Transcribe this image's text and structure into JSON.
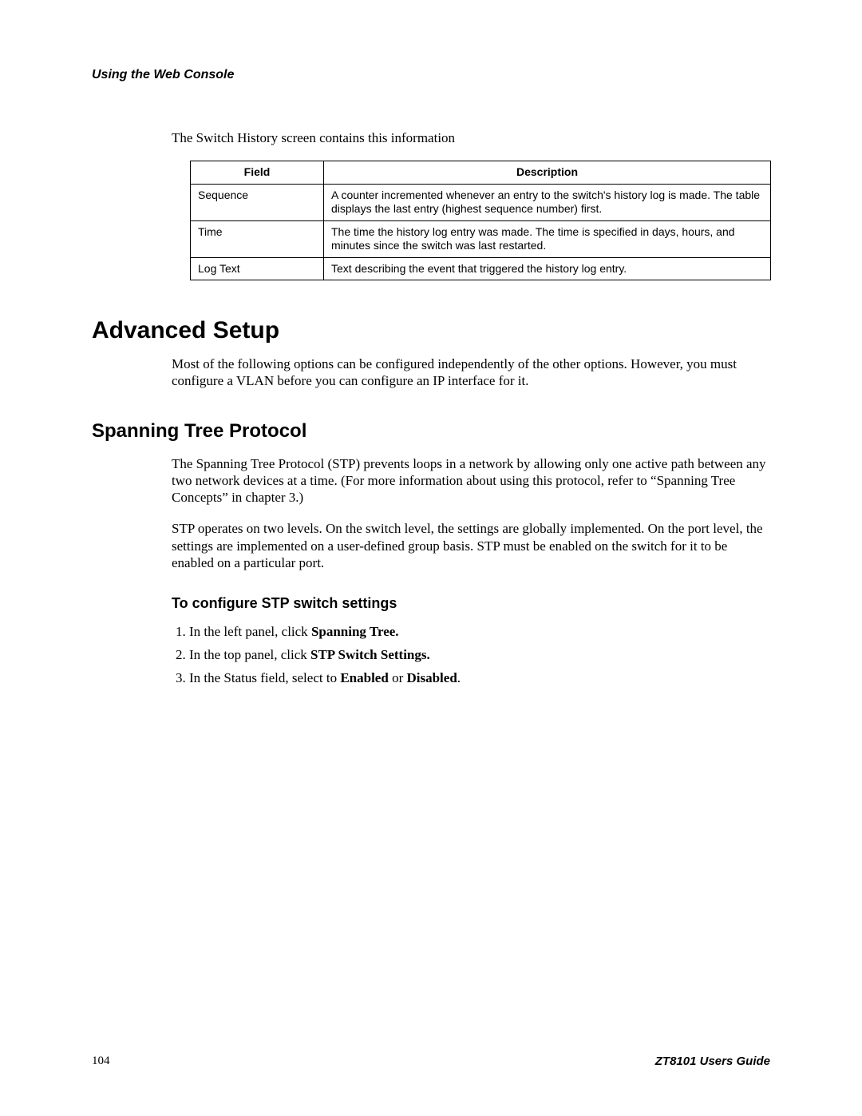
{
  "header": {
    "running_head": "Using the Web Console"
  },
  "intro_line": "The Switch History screen contains this information",
  "table": {
    "col_field": "Field",
    "col_desc": "Description",
    "rows": [
      {
        "field": "Sequence",
        "desc": "A counter incremented whenever an entry to the switch's history log is made. The table displays the last entry (highest sequence number) first."
      },
      {
        "field": "Time",
        "desc": "The time the history log entry was made. The time is specified in days, hours, and minutes since the switch was last restarted."
      },
      {
        "field": "Log Text",
        "desc": "Text describing the event that triggered the history log entry."
      }
    ]
  },
  "h1": "Advanced Setup",
  "p_after_h1": "Most of the following options can be configured independently of the other options. However, you must configure a VLAN before you can configure an IP interface for it.",
  "h2": "Spanning Tree Protocol",
  "p_stp_1": "The Spanning Tree Protocol (STP) prevents loops in a network by allowing only one active path between any two network devices at a time. (For more information about using this protocol, refer to “Spanning Tree Concepts” in chapter 3.)",
  "p_stp_2": "STP operates on two levels. On the switch level, the settings are globally implemented. On the port level, the settings are implemented on a user-defined group basis. STP must be enabled on the switch for it to be enabled on a particular port.",
  "h3": "To configure STP switch settings",
  "steps": {
    "s1a": "In the left panel, click ",
    "s1b": "Spanning Tree.",
    "s2a": "In the top panel, click ",
    "s2b": "STP Switch Settings.",
    "s3a": "In the Status field, select to ",
    "s3b": "Enabled",
    "s3c": " or ",
    "s3d": "Disabled",
    "s3e": "."
  },
  "footer": {
    "page": "104",
    "guide": "ZT8101 Users Guide"
  }
}
